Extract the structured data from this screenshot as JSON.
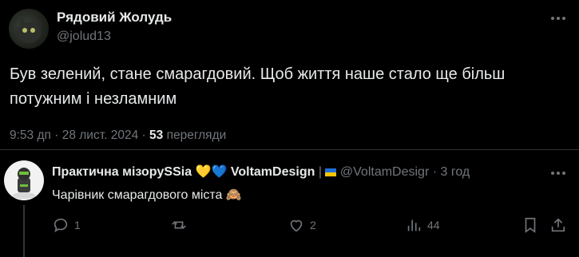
{
  "tweet": {
    "author_name": "Рядовий Жолудь",
    "author_handle": "@jolud13",
    "text": "Був зелений, стане смарагдовий. Щоб життя наше стало ще більш потужним і незламним",
    "time": "9:53 дп",
    "date": "28 лист. 2024",
    "views_count": "53",
    "views_label": "перегляди",
    "separator": "·"
  },
  "reply": {
    "author_name": "Практична мізорySSia",
    "hearts": "💛💙",
    "second_name": "VoltamDesign",
    "badge": "|",
    "author_handle": "@VoltamDesigr",
    "time": "· 3 год",
    "text": "Чарівник смарагдового міста",
    "emoji": "🙈",
    "actions": {
      "reply_count": "1",
      "repost_count": "",
      "like_count": "2",
      "views_count": "44"
    }
  }
}
